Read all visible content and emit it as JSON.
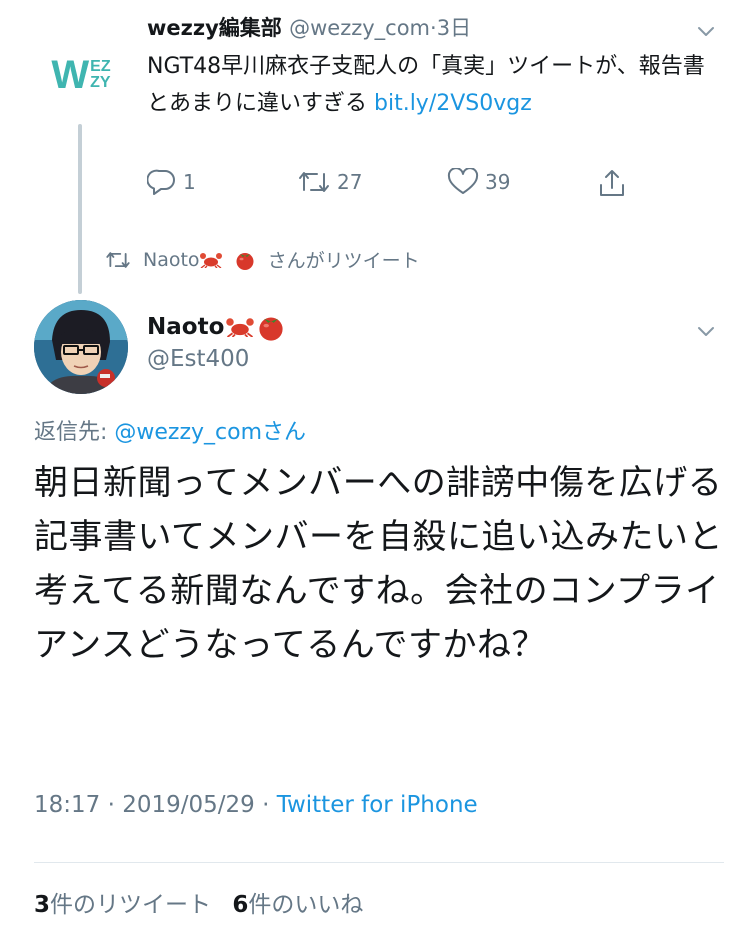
{
  "quoted_tweet": {
    "author_name": "wezzy編集部",
    "author_handle": "@wezzy_com",
    "separator": "·",
    "time": "3日",
    "avatar_letters_big": "W",
    "avatar_letters_small_top": "EZ",
    "avatar_letters_small_bottom": "ZY",
    "text": "NGT48早川麻衣子支配人の「真実」ツイートが、報告書とあまりに違いすぎる ",
    "link_text": "bit.ly/2VS0vgz",
    "replies": "1",
    "retweets": "27",
    "likes": "39"
  },
  "retweet_notice": {
    "name": "Naoto",
    "suffix": "さんがリツイート"
  },
  "main_tweet": {
    "author_name": "Naoto",
    "author_handle": "@Est400",
    "reply_prefix": "返信先: ",
    "reply_to": "@wezzy_comさん",
    "body": "朝日新聞ってメンバーへの誹謗中傷を広げる記事書いてメンバーを自殺に追い込みたいと考えてる新聞なんですね。会社のコンプライアンスどうなってるんですかね？",
    "timestamp": "18:17 · 2019/05/29 · ",
    "source": "Twitter for iPhone",
    "retweet_count": "3",
    "retweet_label": "件のリツイート",
    "like_count": "6",
    "like_label": "件のいいね"
  },
  "icons": [
    "reply-icon",
    "retweet-icon",
    "like-icon",
    "share-icon",
    "chevron-down-icon",
    "crab-emoji",
    "tomato-emoji"
  ],
  "colors": {
    "link": "#1b95e0",
    "muted": "#657786",
    "text": "#14171a",
    "wezzy": "#3fb5b0"
  }
}
